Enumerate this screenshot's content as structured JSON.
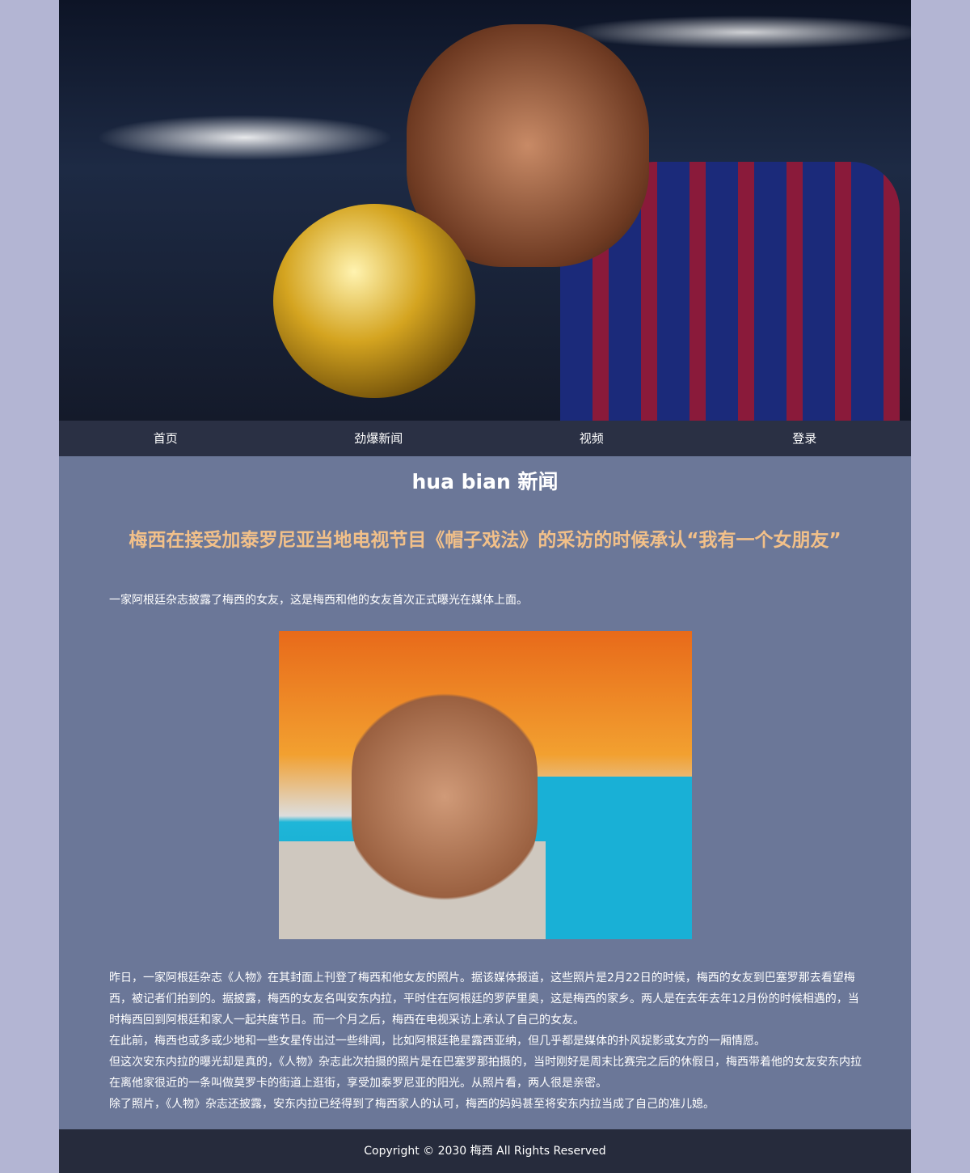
{
  "nav": {
    "items": [
      "首页",
      "劲爆新闻",
      "视频",
      "登录"
    ]
  },
  "site_title": "hua bian 新闻",
  "headline": "梅西在接受加泰罗尼亚当地电视节目《帽子戏法》的采访的时候承认“我有一个女朋友”",
  "lead": "一家阿根廷杂志披露了梅西的女友，这是梅西和他的女友首次正式曝光在媒体上面。",
  "body": [
    "昨日，一家阿根廷杂志《人物》在其封面上刊登了梅西和他女友的照片。据该媒体报道，这些照片是2月22日的时候，梅西的女友到巴塞罗那去看望梅西，被记者们拍到的。据披露，梅西的女友名叫安东内拉，平时住在阿根廷的罗萨里奥，这是梅西的家乡。两人是在去年去年12月份的时候相遇的，当时梅西回到阿根廷和家人一起共度节日。而一个月之后，梅西在电视采访上承认了自己的女友。",
    "在此前，梅西也或多或少地和一些女星传出过一些绯闻，比如阿根廷艳星露西亚纳，但几乎都是媒体的扑风捉影或女方的一厢情愿。",
    "但这次安东内拉的曝光却是真的，《人物》杂志此次拍摄的照片是在巴塞罗那拍摄的，当时刚好是周末比赛完之后的休假日，梅西带着他的女友安东内拉在离他家很近的一条叫做莫罗卡的街道上逛街，享受加泰罗尼亚的阳光。从照片看，两人很是亲密。",
    "除了照片，《人物》杂志还披露，安东内拉已经得到了梅西家人的认可，梅西的妈妈甚至将安东内拉当成了自己的准儿媳。"
  ],
  "footer": "Copyright © 2030 梅西 All Rights Reserved"
}
